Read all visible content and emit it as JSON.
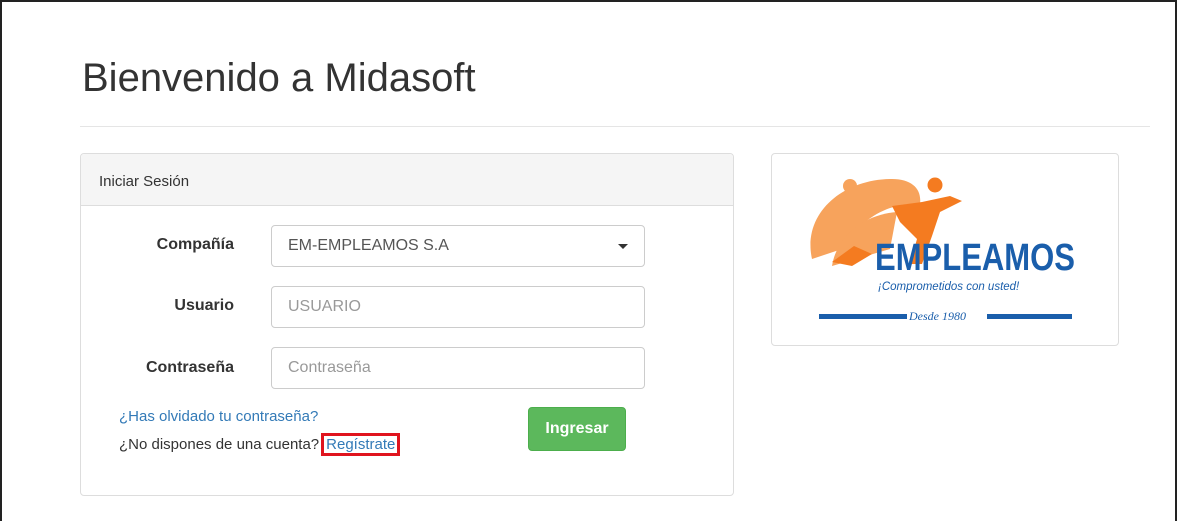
{
  "page": {
    "title": "Bienvenido a Midasoft"
  },
  "login_panel": {
    "heading": "Iniciar Sesión",
    "company": {
      "label": "Compañía",
      "value": "EM-EMPLEAMOS S.A"
    },
    "user": {
      "label": "Usuario",
      "placeholder": "USUARIO"
    },
    "password": {
      "label": "Contraseña",
      "placeholder": "Contraseña"
    },
    "forgot_link": "¿Has olvidado tu contraseña?",
    "no_account_text": "¿No dispones de una cuenta?",
    "register_link": "Regístrate",
    "submit_label": "Ingresar"
  },
  "logo": {
    "brand": "EMPLEAMOS",
    "tagline": "¡Comprometidos con usted!",
    "since": "Desde 1980",
    "colors": {
      "orange": "#f47b20",
      "peach": "#f7a35c",
      "blue": "#1a5eab"
    }
  },
  "colors": {
    "link": "#337ab7",
    "success": "#5cb85c",
    "highlight": "#e0141e"
  }
}
